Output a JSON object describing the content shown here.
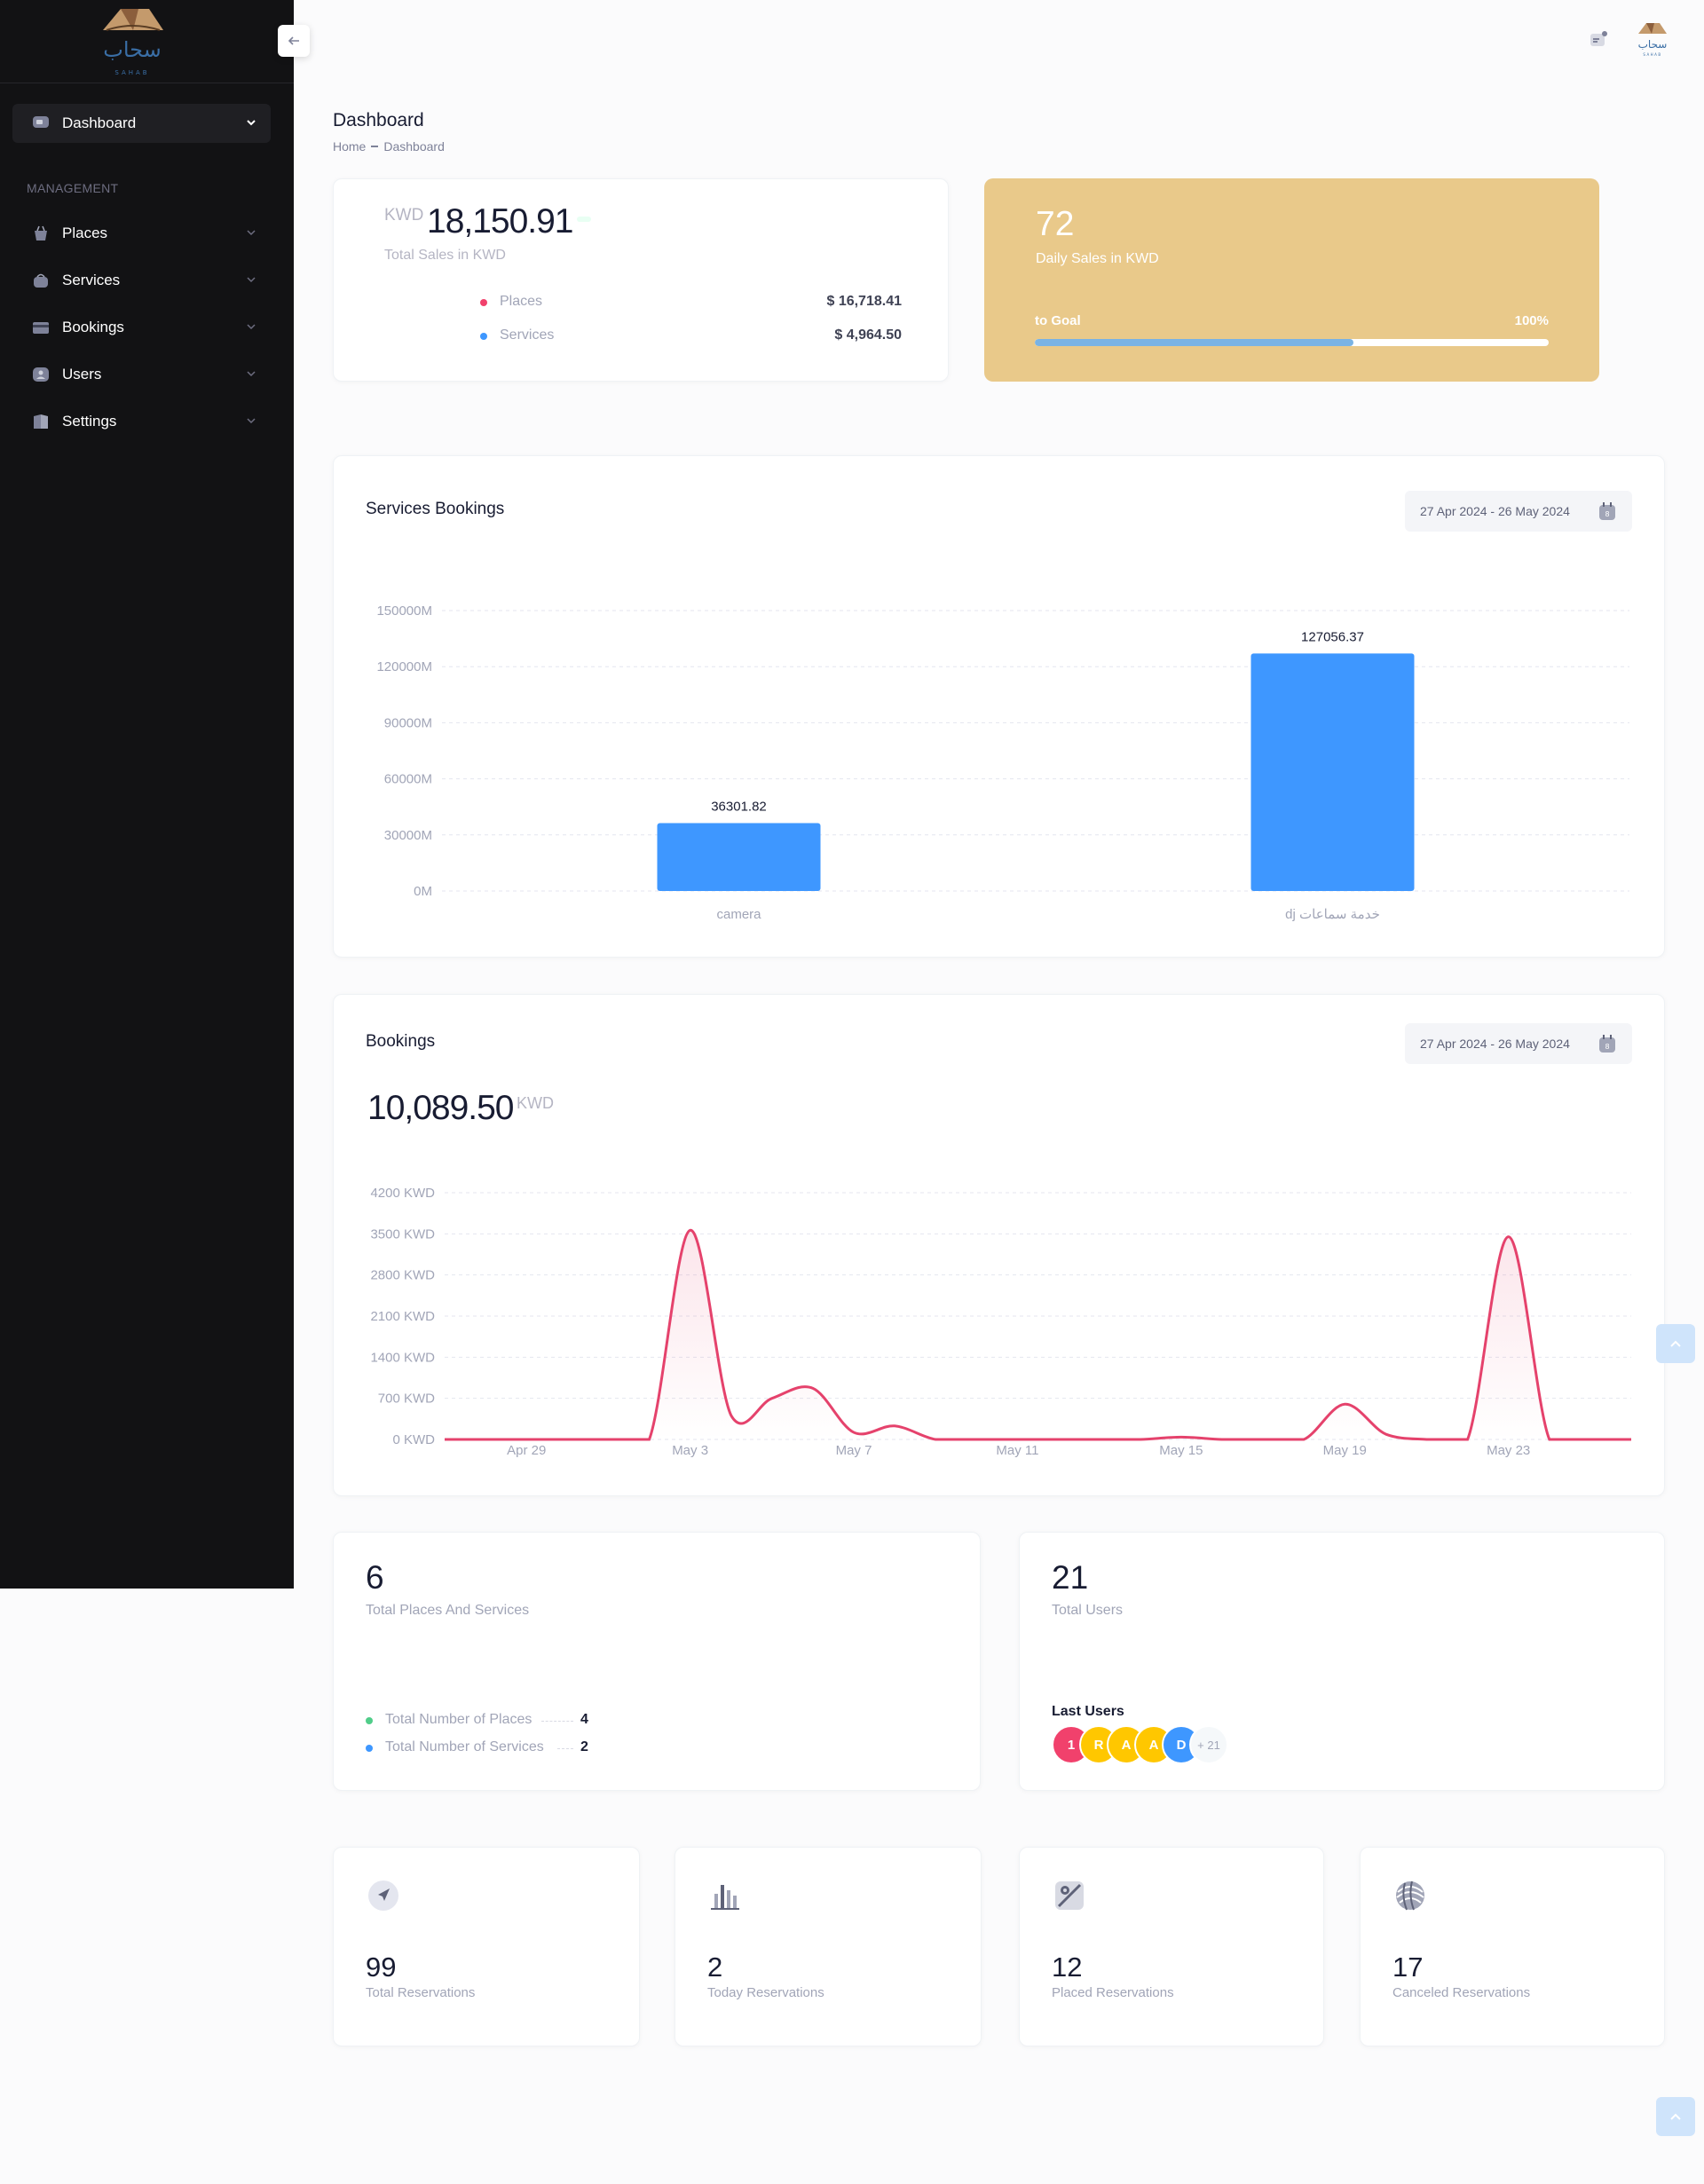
{
  "app": {
    "logo_text": "سحاب",
    "logo_sub": "SAHAB"
  },
  "sidebar": {
    "active_item": "Dashboard",
    "section_label": "MANAGEMENT",
    "items": [
      {
        "label": "Places",
        "icon": "bag-icon"
      },
      {
        "label": "Services",
        "icon": "basket-icon"
      },
      {
        "label": "Bookings",
        "icon": "card-icon"
      },
      {
        "label": "Users",
        "icon": "user-icon"
      },
      {
        "label": "Settings",
        "icon": "book-icon"
      }
    ]
  },
  "page": {
    "title": "Dashboard",
    "breadcrumb": [
      "Home",
      "Dashboard"
    ]
  },
  "total_sales": {
    "currency": "KWD",
    "value": "18,150.91",
    "subtitle": "Total Sales in KWD",
    "rows": [
      {
        "label": "Places",
        "amount": "$ 16,718.41",
        "color": "#f1416c"
      },
      {
        "label": "Services",
        "amount": "$ 4,964.50",
        "color": "#3e97ff"
      }
    ]
  },
  "daily_sales": {
    "value": "72",
    "subtitle": "Daily Sales in KWD",
    "goal_label": "to Goal",
    "goal_pct": "100%",
    "progress_fraction": 0.62,
    "color": "#e9c98a"
  },
  "services_bookings": {
    "title": "Services Bookings",
    "date_range": "27 Apr 2024 - 26 May 2024"
  },
  "bookings": {
    "title": "Bookings",
    "date_range": "27 Apr 2024 - 26 May 2024",
    "total": "10,089.50",
    "currency": "KWD"
  },
  "chart_data": [
    {
      "type": "bar",
      "title": "Services Bookings",
      "categories": [
        "camera",
        "dj خدمة سماعات"
      ],
      "values": [
        36301.82,
        127056.37
      ],
      "value_labels": [
        "36301.82",
        "127056.37"
      ],
      "yticks": [
        "0M",
        "30000M",
        "60000M",
        "90000M",
        "120000M",
        "150000M"
      ],
      "ylim": [
        0,
        150000
      ],
      "grid": true,
      "color": "#3e97ff"
    },
    {
      "type": "area",
      "title": "Bookings",
      "x": [
        "Apr 27",
        "Apr 28",
        "Apr 29",
        "Apr 30",
        "May 1",
        "May 2",
        "May 3",
        "May 4",
        "May 5",
        "May 6",
        "May 7",
        "May 8",
        "May 9",
        "May 10",
        "May 11",
        "May 12",
        "May 13",
        "May 14",
        "May 15",
        "May 16",
        "May 17",
        "May 18",
        "May 19",
        "May 20",
        "May 21",
        "May 22",
        "May 23",
        "May 24",
        "May 25",
        "May 26"
      ],
      "values": [
        0,
        0,
        0,
        0,
        0,
        0,
        3560,
        410,
        700,
        870,
        120,
        230,
        0,
        0,
        0,
        0,
        0,
        0,
        40,
        0,
        0,
        0,
        600,
        90,
        0,
        0,
        3450,
        0,
        0,
        0
      ],
      "xticks": [
        "Apr 29",
        "May 3",
        "May 7",
        "May 11",
        "May 15",
        "May 19",
        "May 23"
      ],
      "yticks": [
        "0 KWD",
        "700 KWD",
        "1400 KWD",
        "2100 KWD",
        "2800 KWD",
        "3500 KWD",
        "4200 KWD"
      ],
      "ylim": [
        0,
        4200
      ],
      "grid": true,
      "color": "#e5426c"
    }
  ],
  "places_services": {
    "value": "6",
    "subtitle": "Total Places And Services",
    "rows": [
      {
        "label": "Total Number of Places",
        "value": "4",
        "color": "#50cd89"
      },
      {
        "label": "Total Number of Services",
        "value": "2",
        "color": "#3e97ff"
      }
    ]
  },
  "users": {
    "value": "21",
    "subtitle": "Total Users",
    "last_users_label": "Last Users",
    "avatars": [
      {
        "letter": "1",
        "color": "#f1416c"
      },
      {
        "letter": "R",
        "color": "#ffc700"
      },
      {
        "letter": "A",
        "color": "#ffc700"
      },
      {
        "letter": "A",
        "color": "#ffc700"
      },
      {
        "letter": "D",
        "color": "#3e97ff"
      }
    ],
    "more": "+ 21"
  },
  "reservations": [
    {
      "value": "99",
      "label": "Total Reservations",
      "icon": "compass-icon"
    },
    {
      "value": "2",
      "label": "Today Reservations",
      "icon": "bar-chart-icon"
    },
    {
      "value": "12",
      "label": "Placed Reservations",
      "icon": "map-icon"
    },
    {
      "value": "17",
      "label": "Canceled Reservations",
      "icon": "sphere-icon"
    }
  ]
}
